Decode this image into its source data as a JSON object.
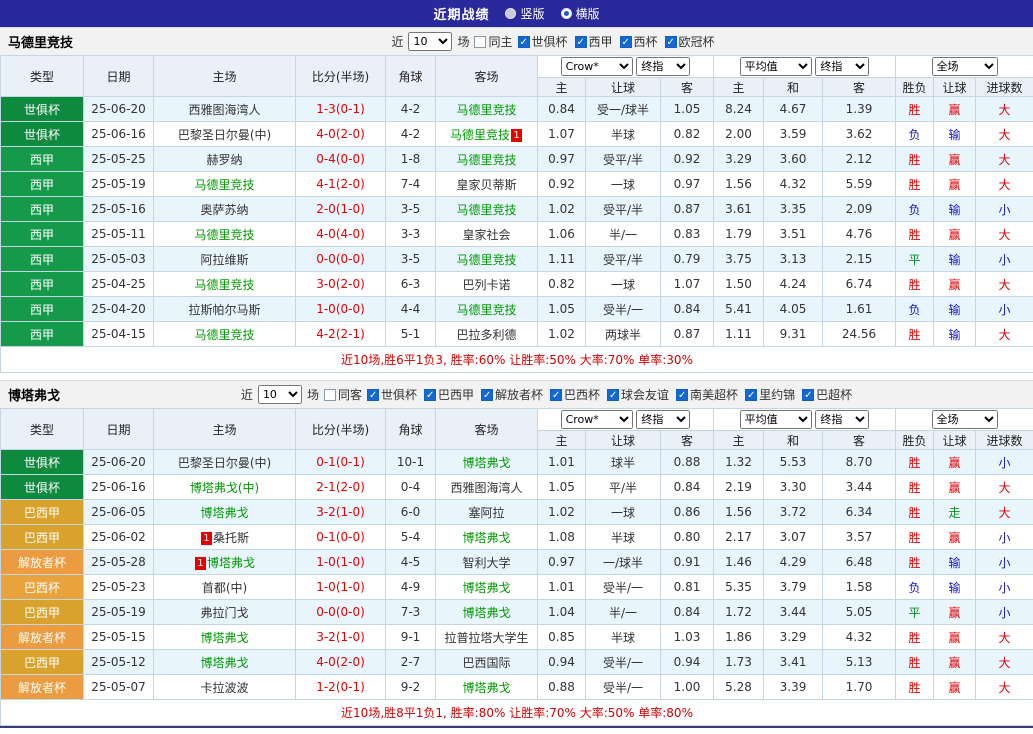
{
  "topbar": {
    "title": "近期战绩",
    "options": [
      {
        "label": "竖版",
        "checked": false
      },
      {
        "label": "横版",
        "checked": true
      }
    ]
  },
  "table_header": {
    "type": "类型",
    "date": "日期",
    "home": "主场",
    "score": "比分(半场)",
    "corner": "角球",
    "away": "客场",
    "odds_source": "Crow*",
    "odds_final": "终指",
    "asian_home": "主",
    "asian_handicap": "让球",
    "asian_away": "客",
    "euro_source": "平均值",
    "euro_final": "终指",
    "euro_home": "主",
    "euro_draw": "和",
    "euro_away": "客",
    "result": "胜负",
    "handicap_result": "让球",
    "goals": "进球数",
    "scope": "全场"
  },
  "colors": {
    "topbar_bg": "#29299B",
    "world_club_cup_green": "#0E8A3E",
    "laliga_green": "#149A4A",
    "brasileirao_gold": "#D8A22C",
    "libertadores_orange": "#EC9C40",
    "copa_brasil_orange": "#E8A33C",
    "win_red": "#E60000",
    "lose_blue": "#1515C8",
    "draw_green": "#089020",
    "team_green": "#009900",
    "row_alt_blue": "#E9F5FD",
    "summary_red": "#D40000"
  },
  "sections": [
    {
      "team": "马德里竞技",
      "filter": {
        "near": "近",
        "count": "10",
        "games": "场",
        "same": "同主",
        "cups": [
          "世俱杯",
          "西甲",
          "西杯",
          "欧冠杯"
        ]
      },
      "rows": [
        {
          "cup": "世俱杯",
          "cup_class": "wcc",
          "date": "25-06-20",
          "home": "西雅图海湾人",
          "home_team": false,
          "home_badge": "",
          "score": "1-3(0-1)",
          "corner": "4-2",
          "away": "马德里竞技",
          "away_team": true,
          "away_badge": "",
          "o_home": "0.84",
          "handicap": "受一/球半",
          "o_away": "1.05",
          "e_home": "8.24",
          "e_draw": "4.67",
          "e_away": "1.39",
          "res": "胜",
          "hres": "赢",
          "gres": "大"
        },
        {
          "cup": "世俱杯",
          "cup_class": "wcc",
          "date": "25-06-16",
          "home": "巴黎圣日尔曼(中)",
          "home_team": false,
          "home_badge": "",
          "score": "4-0(2-0)",
          "corner": "4-2",
          "away": "马德里竞技",
          "away_team": true,
          "away_badge": "1",
          "o_home": "1.07",
          "handicap": "半球",
          "o_away": "0.82",
          "e_home": "2.00",
          "e_draw": "3.59",
          "e_away": "3.62",
          "res": "负",
          "hres": "输",
          "gres": "大"
        },
        {
          "cup": "西甲",
          "cup_class": "laliga",
          "date": "25-05-25",
          "home": "赫罗纳",
          "home_team": false,
          "home_badge": "",
          "score": "0-4(0-0)",
          "corner": "1-8",
          "away": "马德里竞技",
          "away_team": true,
          "away_badge": "",
          "o_home": "0.97",
          "handicap": "受平/半",
          "o_away": "0.92",
          "e_home": "3.29",
          "e_draw": "3.60",
          "e_away": "2.12",
          "res": "胜",
          "hres": "赢",
          "gres": "大"
        },
        {
          "cup": "西甲",
          "cup_class": "laliga",
          "date": "25-05-19",
          "home": "马德里竞技",
          "home_team": true,
          "home_badge": "",
          "score": "4-1(2-0)",
          "corner": "7-4",
          "away": "皇家贝蒂斯",
          "away_team": false,
          "away_badge": "",
          "o_home": "0.92",
          "handicap": "一球",
          "o_away": "0.97",
          "e_home": "1.56",
          "e_draw": "4.32",
          "e_away": "5.59",
          "res": "胜",
          "hres": "赢",
          "gres": "大"
        },
        {
          "cup": "西甲",
          "cup_class": "laliga",
          "date": "25-05-16",
          "home": "奥萨苏纳",
          "home_team": false,
          "home_badge": "",
          "score": "2-0(1-0)",
          "corner": "3-5",
          "away": "马德里竞技",
          "away_team": true,
          "away_badge": "",
          "o_home": "1.02",
          "handicap": "受平/半",
          "o_away": "0.87",
          "e_home": "3.61",
          "e_draw": "3.35",
          "e_away": "2.09",
          "res": "负",
          "hres": "输",
          "gres": "小"
        },
        {
          "cup": "西甲",
          "cup_class": "laliga",
          "date": "25-05-11",
          "home": "马德里竞技",
          "home_team": true,
          "home_badge": "",
          "score": "4-0(4-0)",
          "corner": "3-3",
          "away": "皇家社会",
          "away_team": false,
          "away_badge": "",
          "o_home": "1.06",
          "handicap": "半/一",
          "o_away": "0.83",
          "e_home": "1.79",
          "e_draw": "3.51",
          "e_away": "4.76",
          "res": "胜",
          "hres": "赢",
          "gres": "大"
        },
        {
          "cup": "西甲",
          "cup_class": "laliga",
          "date": "25-05-03",
          "home": "阿拉维斯",
          "home_team": false,
          "home_badge": "",
          "score": "0-0(0-0)",
          "corner": "3-5",
          "away": "马德里竞技",
          "away_team": true,
          "away_badge": "",
          "o_home": "1.11",
          "handicap": "受平/半",
          "o_away": "0.79",
          "e_home": "3.75",
          "e_draw": "3.13",
          "e_away": "2.15",
          "res": "平",
          "hres": "输",
          "gres": "小"
        },
        {
          "cup": "西甲",
          "cup_class": "laliga",
          "date": "25-04-25",
          "home": "马德里竞技",
          "home_team": true,
          "home_badge": "",
          "score": "3-0(2-0)",
          "corner": "6-3",
          "away": "巴列卡诺",
          "away_team": false,
          "away_badge": "",
          "o_home": "0.82",
          "handicap": "一球",
          "o_away": "1.07",
          "e_home": "1.50",
          "e_draw": "4.24",
          "e_away": "6.74",
          "res": "胜",
          "hres": "赢",
          "gres": "大"
        },
        {
          "cup": "西甲",
          "cup_class": "laliga",
          "date": "25-04-20",
          "home": "拉斯帕尔马斯",
          "home_team": false,
          "home_badge": "",
          "score": "1-0(0-0)",
          "corner": "4-4",
          "away": "马德里竞技",
          "away_team": true,
          "away_badge": "",
          "o_home": "1.05",
          "handicap": "受半/一",
          "o_away": "0.84",
          "e_home": "5.41",
          "e_draw": "4.05",
          "e_away": "1.61",
          "res": "负",
          "hres": "输",
          "gres": "小"
        },
        {
          "cup": "西甲",
          "cup_class": "laliga",
          "date": "25-04-15",
          "home": "马德里竞技",
          "home_team": true,
          "home_badge": "",
          "score": "4-2(2-1)",
          "corner": "5-1",
          "away": "巴拉多利德",
          "away_team": false,
          "away_badge": "",
          "o_home": "1.02",
          "handicap": "两球半",
          "o_away": "0.87",
          "e_home": "1.11",
          "e_draw": "9.31",
          "e_away": "24.56",
          "res": "胜",
          "hres": "输",
          "gres": "大"
        }
      ],
      "summary": "近10场,胜6平1负3, 胜率:60% 让胜率:50% 大率:70% 单率:30%"
    },
    {
      "team": "博塔弗戈",
      "filter": {
        "near": "近",
        "count": "10",
        "games": "场",
        "same": "同客",
        "cups": [
          "世俱杯",
          "巴西甲",
          "解放者杯",
          "巴西杯",
          "球会友谊",
          "南美超杯",
          "里约锦",
          "巴超杯"
        ]
      },
      "rows": [
        {
          "cup": "世俱杯",
          "cup_class": "wcc",
          "date": "25-06-20",
          "home": "巴黎圣日尔曼(中)",
          "home_team": false,
          "home_badge": "",
          "score": "0-1(0-1)",
          "corner": "10-1",
          "away": "博塔弗戈",
          "away_team": true,
          "away_badge": "",
          "o_home": "1.01",
          "handicap": "球半",
          "o_away": "0.88",
          "e_home": "1.32",
          "e_draw": "5.53",
          "e_away": "8.70",
          "res": "胜",
          "hres": "赢",
          "gres": "小"
        },
        {
          "cup": "世俱杯",
          "cup_class": "wcc",
          "date": "25-06-16",
          "home": "博塔弗戈(中)",
          "home_team": true,
          "home_badge": "",
          "score": "2-1(2-0)",
          "corner": "0-4",
          "away": "西雅图海湾人",
          "away_team": false,
          "away_badge": "",
          "o_home": "1.05",
          "handicap": "平/半",
          "o_away": "0.84",
          "e_home": "2.19",
          "e_draw": "3.30",
          "e_away": "3.44",
          "res": "胜",
          "hres": "赢",
          "gres": "大"
        },
        {
          "cup": "巴西甲",
          "cup_class": "bra",
          "date": "25-06-05",
          "home": "博塔弗戈",
          "home_team": true,
          "home_badge": "",
          "score": "3-2(1-0)",
          "corner": "6-0",
          "away": "塞阿拉",
          "away_team": false,
          "away_badge": "",
          "o_home": "1.02",
          "handicap": "一球",
          "o_away": "0.86",
          "e_home": "1.56",
          "e_draw": "3.72",
          "e_away": "6.34",
          "res": "胜",
          "hres": "走",
          "gres": "大"
        },
        {
          "cup": "巴西甲",
          "cup_class": "bra",
          "date": "25-06-02",
          "home": "桑托斯",
          "home_team": false,
          "home_badge": "1",
          "score": "0-1(0-0)",
          "corner": "5-4",
          "away": "博塔弗戈",
          "away_team": true,
          "away_badge": "",
          "o_home": "1.08",
          "handicap": "半球",
          "o_away": "0.80",
          "e_home": "2.17",
          "e_draw": "3.07",
          "e_away": "3.57",
          "res": "胜",
          "hres": "赢",
          "gres": "小"
        },
        {
          "cup": "解放者杯",
          "cup_class": "lib",
          "date": "25-05-28",
          "home": "博塔弗戈",
          "home_team": true,
          "home_badge": "1",
          "score": "1-0(1-0)",
          "corner": "4-5",
          "away": "智利大学",
          "away_team": false,
          "away_badge": "",
          "o_home": "0.97",
          "handicap": "一/球半",
          "o_away": "0.91",
          "e_home": "1.46",
          "e_draw": "4.29",
          "e_away": "6.48",
          "res": "胜",
          "hres": "输",
          "gres": "小"
        },
        {
          "cup": "巴西杯",
          "cup_class": "bcup",
          "date": "25-05-23",
          "home": "首都(中)",
          "home_team": false,
          "home_badge": "",
          "score": "1-0(1-0)",
          "corner": "4-9",
          "away": "博塔弗戈",
          "away_team": true,
          "away_badge": "",
          "o_home": "1.01",
          "handicap": "受半/一",
          "o_away": "0.81",
          "e_home": "5.35",
          "e_draw": "3.79",
          "e_away": "1.58",
          "res": "负",
          "hres": "输",
          "gres": "小"
        },
        {
          "cup": "巴西甲",
          "cup_class": "bra",
          "date": "25-05-19",
          "home": "弗拉门戈",
          "home_team": false,
          "home_badge": "",
          "score": "0-0(0-0)",
          "corner": "7-3",
          "away": "博塔弗戈",
          "away_team": true,
          "away_badge": "",
          "o_home": "1.04",
          "handicap": "半/一",
          "o_away": "0.84",
          "e_home": "1.72",
          "e_draw": "3.44",
          "e_away": "5.05",
          "res": "平",
          "hres": "赢",
          "gres": "小"
        },
        {
          "cup": "解放者杯",
          "cup_class": "lib",
          "date": "25-05-15",
          "home": "博塔弗戈",
          "home_team": true,
          "home_badge": "",
          "score": "3-2(1-0)",
          "corner": "9-1",
          "away": "拉普拉塔大学生",
          "away_team": false,
          "away_badge": "",
          "o_home": "0.85",
          "handicap": "半球",
          "o_away": "1.03",
          "e_home": "1.86",
          "e_draw": "3.29",
          "e_away": "4.32",
          "res": "胜",
          "hres": "赢",
          "gres": "大"
        },
        {
          "cup": "巴西甲",
          "cup_class": "bra",
          "date": "25-05-12",
          "home": "博塔弗戈",
          "home_team": true,
          "home_badge": "",
          "score": "4-0(2-0)",
          "corner": "2-7",
          "away": "巴西国际",
          "away_team": false,
          "away_badge": "",
          "o_home": "0.94",
          "handicap": "受半/一",
          "o_away": "0.94",
          "e_home": "1.73",
          "e_draw": "3.41",
          "e_away": "5.13",
          "res": "胜",
          "hres": "赢",
          "gres": "大"
        },
        {
          "cup": "解放者杯",
          "cup_class": "lib",
          "date": "25-05-07",
          "home": "卡拉波波",
          "home_team": false,
          "home_badge": "",
          "score": "1-2(0-1)",
          "corner": "9-2",
          "away": "博塔弗戈",
          "away_team": true,
          "away_badge": "",
          "o_home": "0.88",
          "handicap": "受半/一",
          "o_away": "1.00",
          "e_home": "5.28",
          "e_draw": "3.39",
          "e_away": "1.70",
          "res": "胜",
          "hres": "赢",
          "gres": "大"
        }
      ],
      "summary": "近10场,胜8平1负1, 胜率:80% 让胜率:70% 大率:50% 单率:80%"
    }
  ]
}
